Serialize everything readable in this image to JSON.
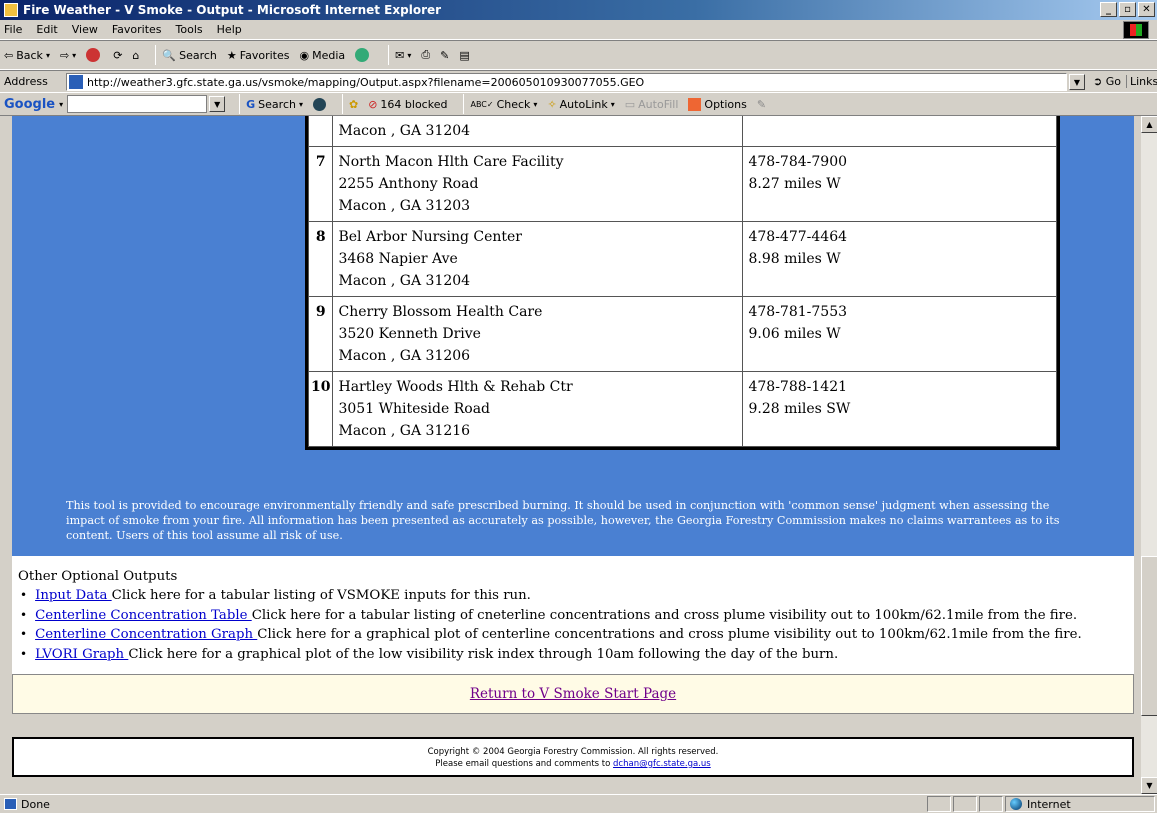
{
  "window": {
    "title": "Fire Weather - V Smoke - Output - Microsoft Internet Explorer"
  },
  "menu": {
    "items": [
      "File",
      "Edit",
      "View",
      "Favorites",
      "Tools",
      "Help"
    ]
  },
  "toolbar": {
    "back": "Back",
    "search": "Search",
    "favorites": "Favorites",
    "media": "Media"
  },
  "address": {
    "label": "Address",
    "url": "http://weather3.gfc.state.ga.us/vsmoke/mapping/Output.aspx?filename=200605010930077055.GEO",
    "go": "Go",
    "links": "Links"
  },
  "google": {
    "logo": "Google",
    "search": "Search",
    "blocked": "164 blocked",
    "check": "Check",
    "autolink": "AutoLink",
    "autofill": "AutoFill",
    "options": "Options"
  },
  "facilities": [
    {
      "num": "",
      "line1": "Macon , GA 31204",
      "line2": "",
      "line3": "",
      "phone": "",
      "distance": ""
    },
    {
      "num": "7",
      "line1": "North Macon Hlth Care Facility",
      "line2": "2255 Anthony Road",
      "line3": "Macon , GA 31203",
      "phone": "478-784-7900",
      "distance": "8.27 miles W"
    },
    {
      "num": "8",
      "line1": "Bel Arbor Nursing Center",
      "line2": "3468 Napier Ave",
      "line3": "Macon , GA 31204",
      "phone": "478-477-4464",
      "distance": "8.98 miles W"
    },
    {
      "num": "9",
      "line1": "Cherry Blossom Health Care",
      "line2": "3520 Kenneth Drive",
      "line3": "Macon , GA 31206",
      "phone": "478-781-7553",
      "distance": "9.06 miles W"
    },
    {
      "num": "10",
      "line1": "Hartley Woods Hlth & Rehab Ctr",
      "line2": "3051 Whiteside Road",
      "line3": "Macon , GA 31216",
      "phone": "478-788-1421",
      "distance": "9.28 miles SW"
    }
  ],
  "disclaimer": "This tool is provided to encourage environmentally friendly and safe prescribed burning. It should be used in conjunction with 'common sense' judgment when assessing the impact of smoke from your fire. All information has been presented as accurately as possible, however, the Georgia Forestry Commission makes no claims warrantees as to its content. Users of this tool assume all risk of use.",
  "outputs": {
    "heading": "Other Optional Outputs",
    "items": [
      {
        "link": "Input Data ",
        "text": "Click here for a tabular listing of VSMOKE inputs for this run."
      },
      {
        "link": "Centerline Concentration Table ",
        "text": "Click here for a tabular listing of cneterline concentrations and cross plume visibility out to 100km/62.1mile from the fire."
      },
      {
        "link": "Centerline Concentration Graph ",
        "text": "Click here for a graphical plot of centerline concentrations and cross plume visibility out to 100km/62.1mile from the fire."
      },
      {
        "link": "LVORI Graph ",
        "text": "Click here for a graphical plot of the low visibility risk index through 10am following the day of the burn."
      }
    ]
  },
  "return_link": "Return to V Smoke Start Page",
  "footer": {
    "copyright": "Copyright © 2004 Georgia Forestry Commission. All rights reserved.",
    "email_prefix": "Please email questions and comments to ",
    "email": "dchan@gfc.state.ga.us"
  },
  "status": {
    "text": "Done",
    "zone": "Internet"
  }
}
